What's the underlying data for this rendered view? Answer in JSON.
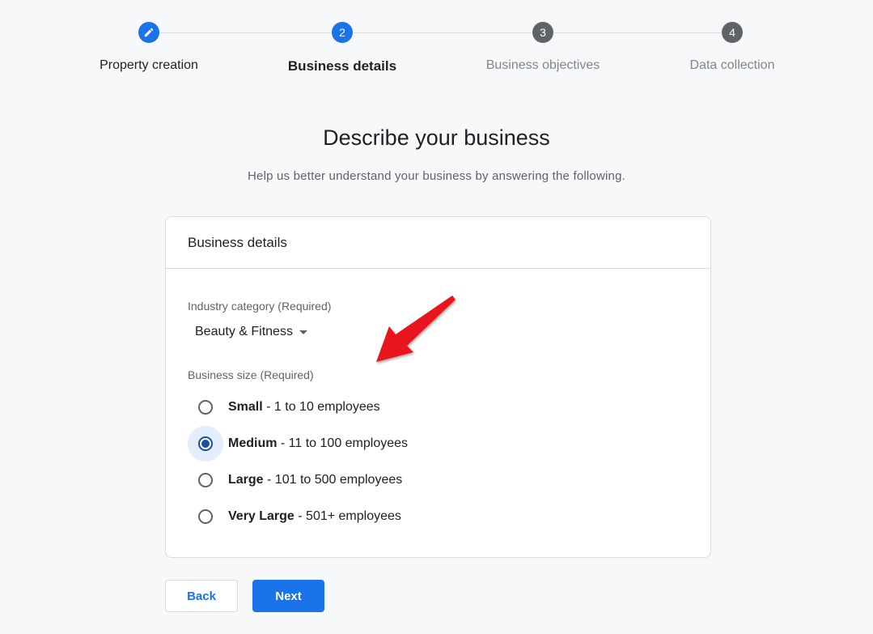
{
  "stepper": {
    "steps": [
      {
        "number": "",
        "label": "Property creation",
        "state": "done"
      },
      {
        "number": "2",
        "label": "Business details",
        "state": "active"
      },
      {
        "number": "3",
        "label": "Business objectives",
        "state": "todo"
      },
      {
        "number": "4",
        "label": "Data collection",
        "state": "todo"
      }
    ]
  },
  "heading": {
    "title": "Describe your business",
    "subtitle": "Help us better understand your business by answering the following."
  },
  "card": {
    "header": "Business details",
    "industry": {
      "label": "Industry category (Required)",
      "value": "Beauty & Fitness"
    },
    "size": {
      "label": "Business size (Required)",
      "options": [
        {
          "name": "Small",
          "detail": " - 1 to 10 employees",
          "selected": false
        },
        {
          "name": "Medium",
          "detail": " - 11 to 100 employees",
          "selected": true
        },
        {
          "name": "Large",
          "detail": " - 101 to 500 employees",
          "selected": false
        },
        {
          "name": "Very Large",
          "detail": " - 501+ employees",
          "selected": false
        }
      ]
    }
  },
  "buttons": {
    "back_label": "Back",
    "next_label": "Next"
  },
  "colors": {
    "primary": "#1a73e8",
    "annotation_arrow": "#e8151b"
  },
  "icons": {
    "step_1": "pencil-edit-icon",
    "annotation": "red-arrow-icon"
  }
}
